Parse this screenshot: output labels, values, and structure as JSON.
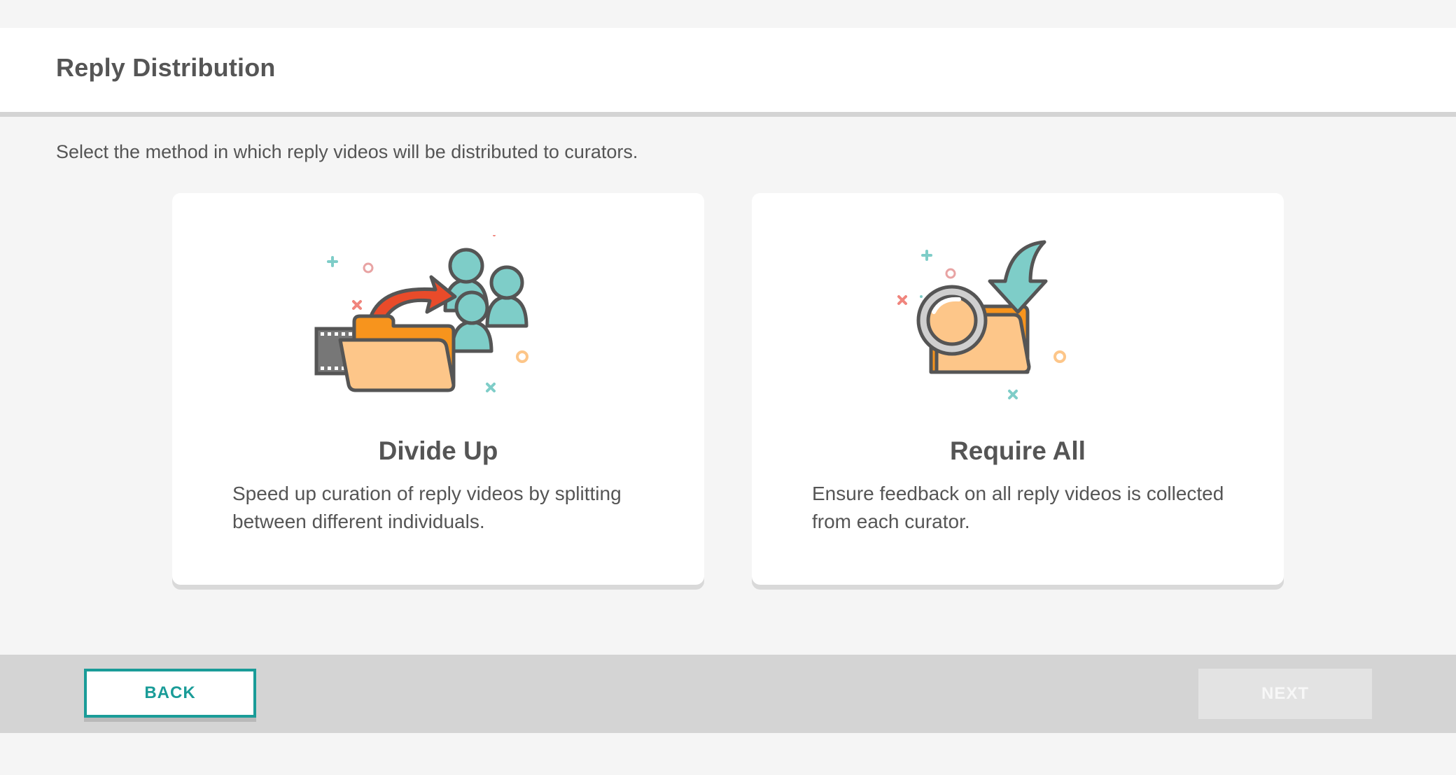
{
  "header": {
    "title": "Reply Distribution"
  },
  "instructions": "Select the method in which reply videos will be distributed to curators.",
  "options": [
    {
      "title": "Divide Up",
      "description": "Speed up curation of reply videos by splitting between different individuals.",
      "icon": "folder-share-people-icon"
    },
    {
      "title": "Require All",
      "description": "Ensure feedback on all reply videos is collected from each curator.",
      "icon": "folder-magnifier-icon"
    }
  ],
  "footer": {
    "back_label": "BACK",
    "next_label": "NEXT"
  },
  "colors": {
    "accent": "#1a9c98",
    "orange": "#f7941d",
    "light_orange": "#fdc689",
    "teal": "#7ecdc8",
    "red": "#e94b2a"
  }
}
